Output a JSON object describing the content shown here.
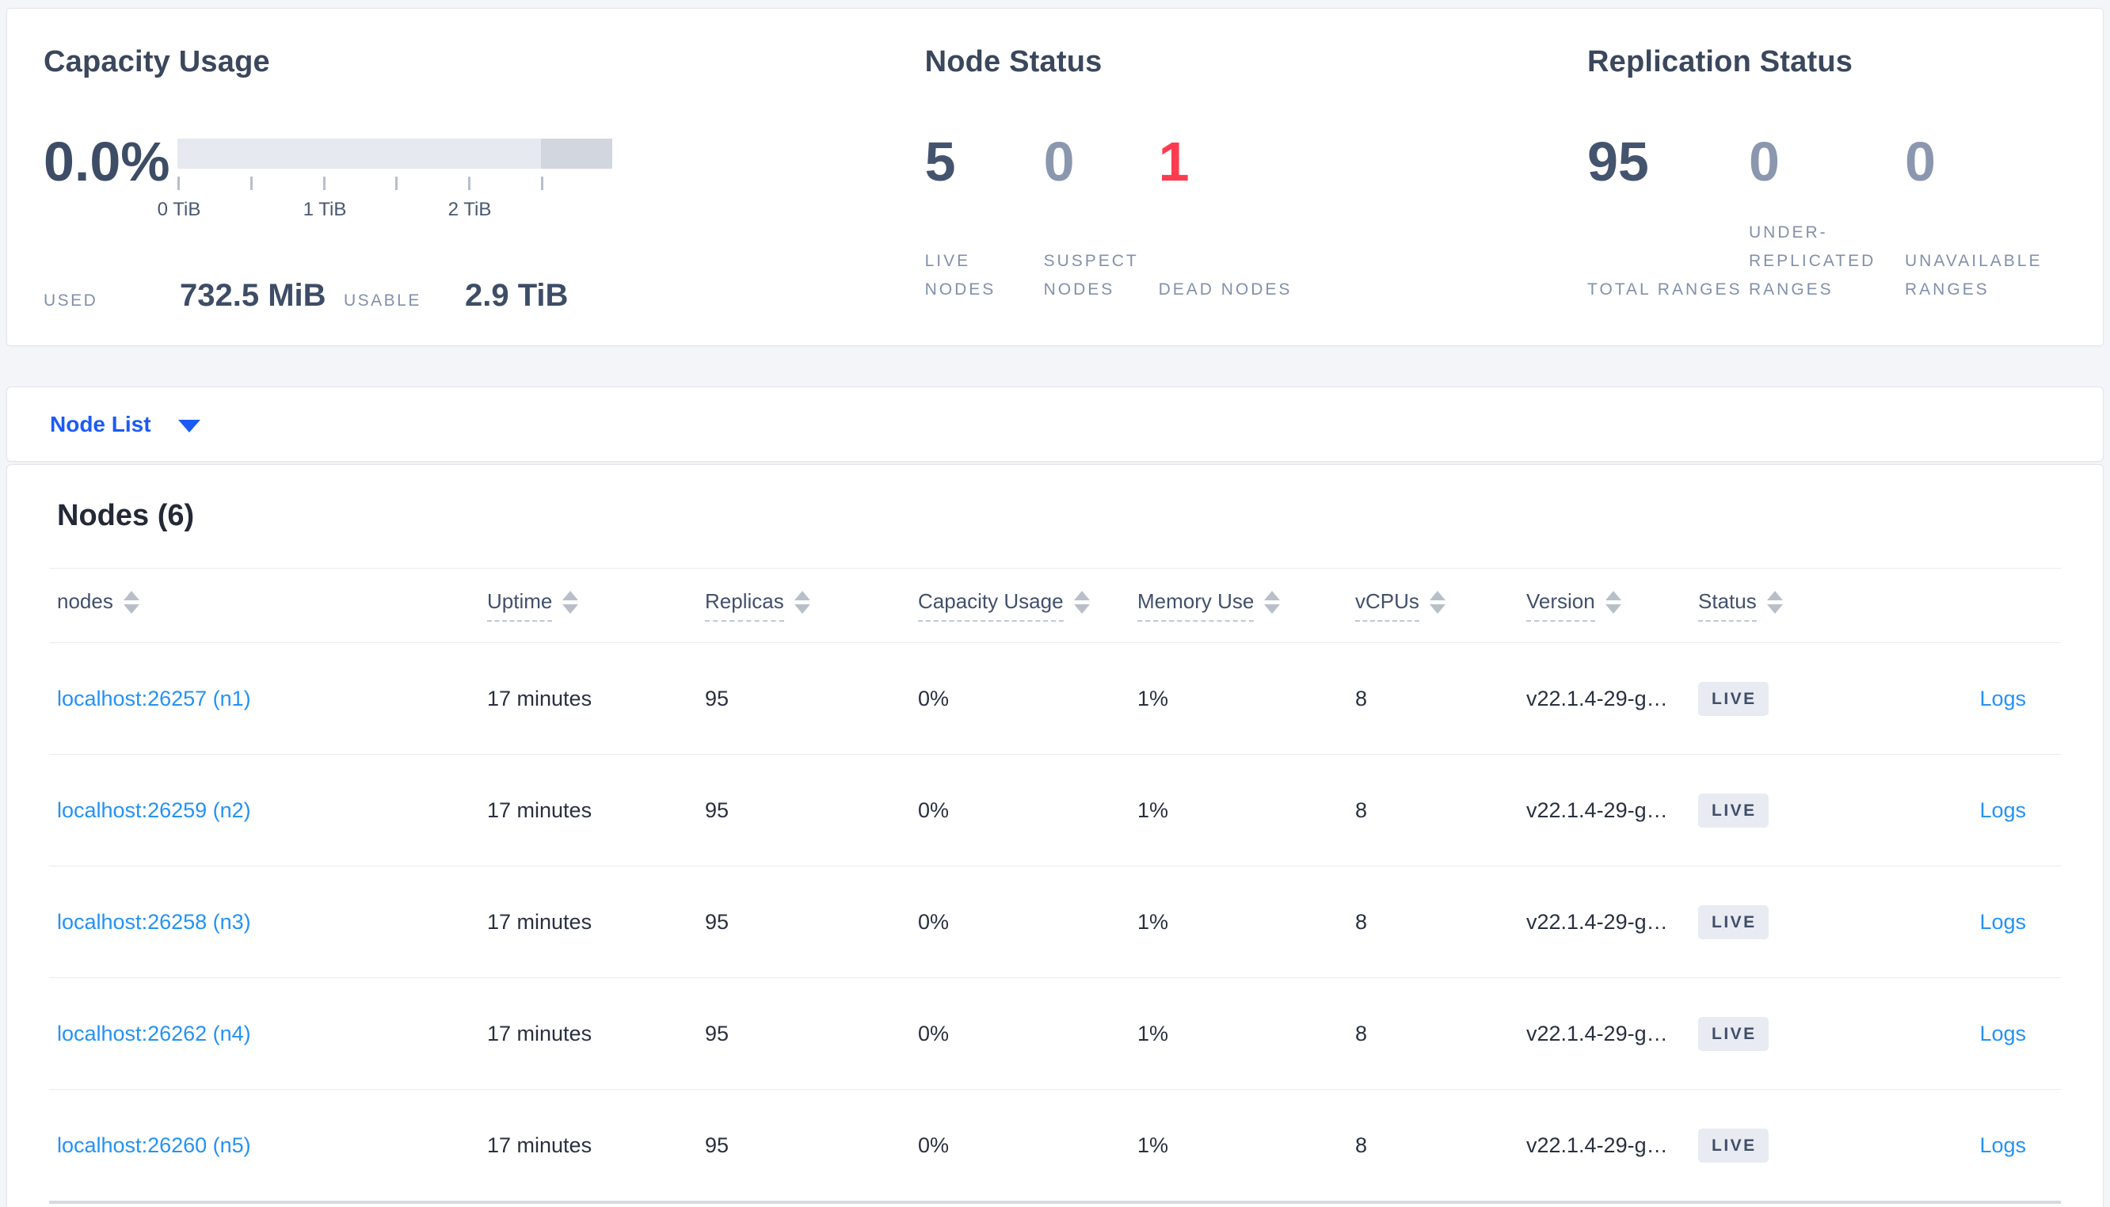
{
  "colors": {
    "accent_blue": "#1b5bf5",
    "link_blue": "#2492f5",
    "dead_red": "#ff3b4f",
    "muted_number": "#8b97ae",
    "dark_number": "#45546e",
    "badge_bg": "#e8ebf1",
    "bar_light": "#e7e9f0",
    "bar_dark": "#d2d6de"
  },
  "summary": {
    "capacity": {
      "title": "Capacity Usage",
      "percent": "0.0%",
      "tick_labels": [
        "0 TiB",
        "1 TiB",
        "2 TiB"
      ],
      "used_label": "USED",
      "used_value": "732.5 MiB",
      "usable_label": "USABLE",
      "usable_value": "2.9 TiB"
    },
    "node_status": {
      "title": "Node Status",
      "live_value": "5",
      "live_label": "LIVE NODES",
      "suspect_value": "0",
      "suspect_label": "SUSPECT NODES",
      "dead_value": "1",
      "dead_label": "DEAD NODES"
    },
    "replication": {
      "title": "Replication Status",
      "total_value": "95",
      "total_label": "TOTAL RANGES",
      "under_value": "0",
      "under_label": "UNDER-REPLICATED RANGES",
      "unavailable_value": "0",
      "unavailable_label": "UNAVAILABLE RANGES"
    }
  },
  "node_list": {
    "label": "Node List"
  },
  "table": {
    "title": "Nodes (6)",
    "columns": {
      "nodes": "nodes",
      "uptime": "Uptime",
      "replicas": "Replicas",
      "capacity": "Capacity Usage",
      "memory": "Memory Use",
      "vcpus": "vCPUs",
      "version": "Version",
      "status": "Status"
    },
    "rows": [
      {
        "node": "localhost:26257 (n1)",
        "uptime": "17 minutes",
        "replicas": "95",
        "capacity": "0%",
        "memory": "1%",
        "vcpus": "8",
        "version": "v22.1.4-29-g…",
        "status": "LIVE",
        "logs": "Logs"
      },
      {
        "node": "localhost:26259 (n2)",
        "uptime": "17 minutes",
        "replicas": "95",
        "capacity": "0%",
        "memory": "1%",
        "vcpus": "8",
        "version": "v22.1.4-29-g…",
        "status": "LIVE",
        "logs": "Logs"
      },
      {
        "node": "localhost:26258 (n3)",
        "uptime": "17 minutes",
        "replicas": "95",
        "capacity": "0%",
        "memory": "1%",
        "vcpus": "8",
        "version": "v22.1.4-29-g…",
        "status": "LIVE",
        "logs": "Logs"
      },
      {
        "node": "localhost:26262 (n4)",
        "uptime": "17 minutes",
        "replicas": "95",
        "capacity": "0%",
        "memory": "1%",
        "vcpus": "8",
        "version": "v22.1.4-29-g…",
        "status": "LIVE",
        "logs": "Logs"
      },
      {
        "node": "localhost:26260 (n5)",
        "uptime": "17 minutes",
        "replicas": "95",
        "capacity": "0%",
        "memory": "1%",
        "vcpus": "8",
        "version": "v22.1.4-29-g…",
        "status": "LIVE",
        "logs": "Logs"
      }
    ]
  }
}
